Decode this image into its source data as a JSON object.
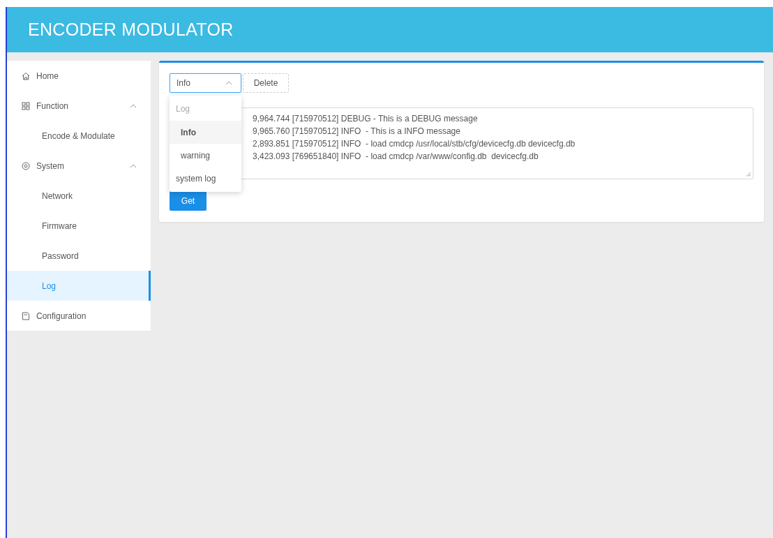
{
  "header": {
    "title": "ENCODER MODULATOR"
  },
  "sidebar": {
    "items": [
      {
        "label": "Home",
        "kind": "home",
        "selected": false
      },
      {
        "label": "Function",
        "kind": "grid",
        "selected": false,
        "expanded": true,
        "children": [
          {
            "label": "Encode & Modulate",
            "selected": false
          }
        ]
      },
      {
        "label": "System",
        "kind": "gear",
        "selected": false,
        "expanded": true,
        "children": [
          {
            "label": "Network",
            "selected": false
          },
          {
            "label": "Firmware",
            "selected": false
          },
          {
            "label": "Password",
            "selected": false
          },
          {
            "label": "Log",
            "selected": true
          }
        ]
      },
      {
        "label": "Configuration",
        "kind": "doc",
        "selected": false
      }
    ]
  },
  "log_panel": {
    "select": {
      "value": "Info",
      "expanded": true
    },
    "delete_button": "Delete",
    "dropdown": [
      {
        "kind": "group",
        "label": "Log",
        "selected": false
      },
      {
        "kind": "option",
        "label": "Info",
        "selected": true
      },
      {
        "kind": "option",
        "label": "warning",
        "selected": false
      },
      {
        "kind": "group",
        "label": "system log",
        "selected": false
      }
    ],
    "log_lines": [
      "9,964.744 [715970512] DEBUG - This is a DEBUG message",
      "9,965.760 [715970512] INFO  - This is a INFO message",
      "2,893.851 [715970512] INFO  - load cmdcp /usr/local/stb/cfg/devicecfg.db devicecfg.db",
      "3,423.093 [769651840] INFO  - load cmdcp /var/www/config.db  devicecfg.db"
    ],
    "get_button": "Get"
  }
}
